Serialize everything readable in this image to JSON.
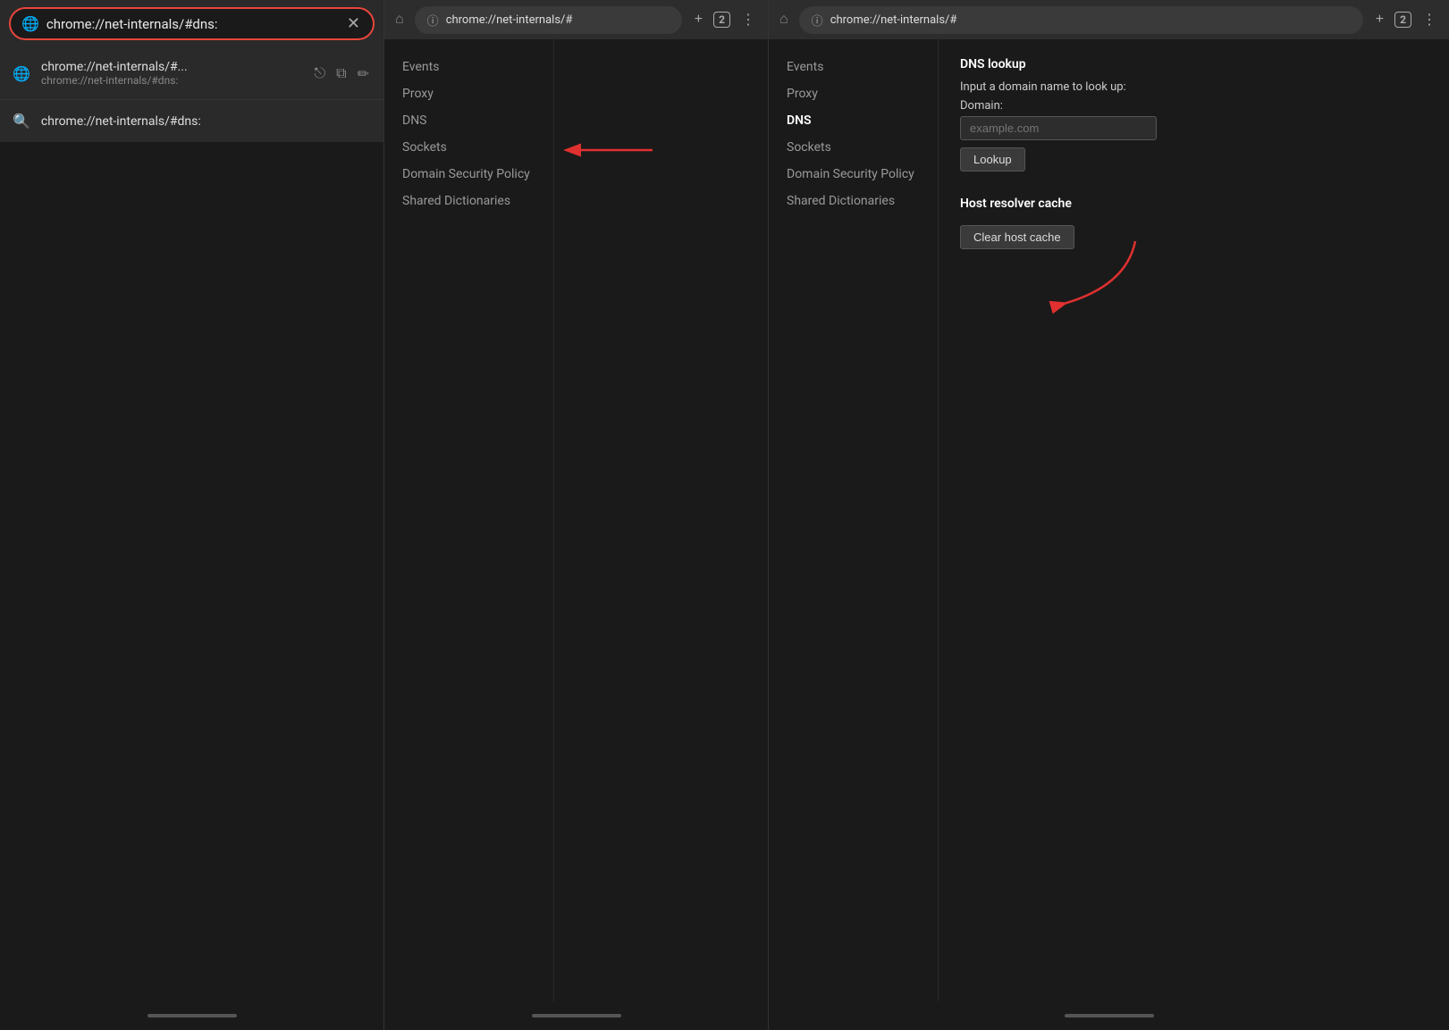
{
  "panel1": {
    "addressBar": {
      "url": "chrome://net-internals/#dns:",
      "placeholder": "chrome://net-internals/#dns:"
    },
    "autocomplete": [
      {
        "id": "history-item",
        "icon": "globe",
        "title": "chrome://net-internals/#...",
        "subtitle": "chrome://net-internals/#dns:",
        "hasActions": true
      }
    ],
    "searchItem": {
      "text": "chrome://net-internals/#dns:"
    }
  },
  "panel2": {
    "toolbar": {
      "url": "chrome://net-internals/#",
      "tabCount": "2"
    },
    "nav": {
      "items": [
        {
          "label": "Events",
          "active": false
        },
        {
          "label": "Proxy",
          "active": false
        },
        {
          "label": "DNS",
          "active": false
        },
        {
          "label": "Sockets",
          "active": false
        },
        {
          "label": "Domain Security Policy",
          "active": false
        },
        {
          "label": "Shared Dictionaries",
          "active": false
        }
      ]
    }
  },
  "panel3": {
    "toolbar": {
      "url": "chrome://net-internals/#",
      "tabCount": "2"
    },
    "nav": {
      "items": [
        {
          "label": "Events",
          "active": false
        },
        {
          "label": "Proxy",
          "active": false
        },
        {
          "label": "DNS",
          "active": true
        },
        {
          "label": "Sockets",
          "active": false
        },
        {
          "label": "Domain Security Policy",
          "active": false
        },
        {
          "label": "Shared Dictionaries",
          "active": false
        }
      ]
    },
    "dnsLookup": {
      "sectionTitle": "DNS lookup",
      "descriptionLabel": "Input a domain name to look up:",
      "domainLabel": "Domain:",
      "domainPlaceholder": "example.com",
      "lookupButtonLabel": "Lookup"
    },
    "hostCache": {
      "sectionTitle": "Host resolver cache",
      "clearButtonLabel": "Clear host cache"
    }
  },
  "icons": {
    "globe": "🌐",
    "share": "⎋",
    "copy": "⧉",
    "edit": "✏",
    "search": "🔍",
    "close": "✕",
    "lock": "ⓘ",
    "home": "⌂",
    "more": "⋮",
    "plus": "+"
  }
}
